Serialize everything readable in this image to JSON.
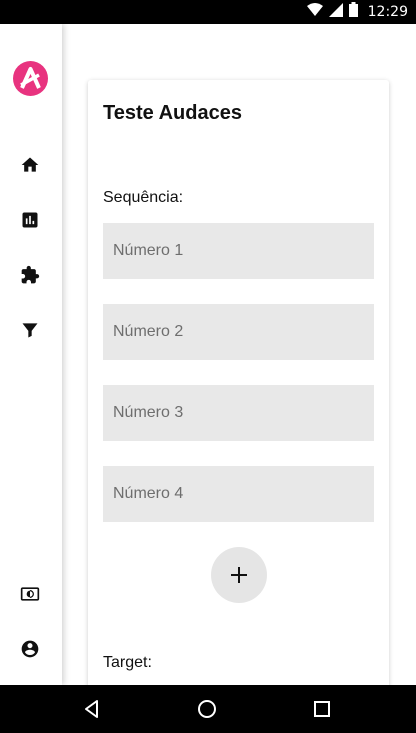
{
  "status_bar": {
    "time": "12:29"
  },
  "sidebar": {
    "logo": "audaces-logo",
    "items": [
      {
        "icon": "home-icon"
      },
      {
        "icon": "chart-icon"
      },
      {
        "icon": "puzzle-icon"
      },
      {
        "icon": "filter-icon"
      }
    ],
    "bottom_items": [
      {
        "icon": "theme-toggle-icon"
      },
      {
        "icon": "account-icon"
      }
    ]
  },
  "card": {
    "title": "Teste Audaces",
    "sequence_label": "Sequência:",
    "inputs": [
      {
        "value": "",
        "placeholder": "Número 1"
      },
      {
        "value": "",
        "placeholder": "Número 2"
      },
      {
        "value": "",
        "placeholder": "Número 3"
      },
      {
        "value": "",
        "placeholder": "Número 4"
      }
    ],
    "add_button_icon": "plus-icon",
    "target_label": "Target:"
  },
  "colors": {
    "brand": "#e8337f",
    "input_bg": "#e8e8e8",
    "system_bar": "#000000"
  },
  "nav_bar": {
    "buttons": [
      "back-icon",
      "home-circle-icon",
      "recents-icon"
    ]
  }
}
